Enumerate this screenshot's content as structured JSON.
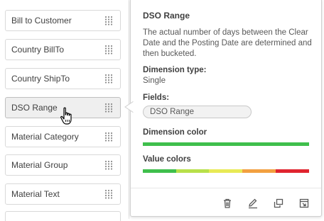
{
  "dimensions": [
    {
      "label": "Bill to Customer"
    },
    {
      "label": "Country BillTo"
    },
    {
      "label": "Country ShipTo"
    },
    {
      "label": "DSO Range"
    },
    {
      "label": "Material Category"
    },
    {
      "label": "Material Group"
    },
    {
      "label": "Material Text"
    }
  ],
  "popover": {
    "title": "DSO Range",
    "description": "The actual number of days between the Clear Date and the Posting Date are determined and then bucketed.",
    "dimension_type_label": "Dimension type:",
    "dimension_type_value": "Single",
    "fields_label": "Fields:",
    "field_chip": "DSO Range",
    "dimension_color_label": "Dimension color",
    "dimension_color": "#3fbf4c",
    "value_colors_label": "Value colors",
    "value_colors": [
      "#3fbf4c",
      "#b8e04a",
      "#e8ea55",
      "#f2a040",
      "#e0242f"
    ]
  },
  "footer_icons": [
    "trash-icon",
    "edit-icon",
    "duplicate-icon",
    "open-in-new-icon"
  ]
}
